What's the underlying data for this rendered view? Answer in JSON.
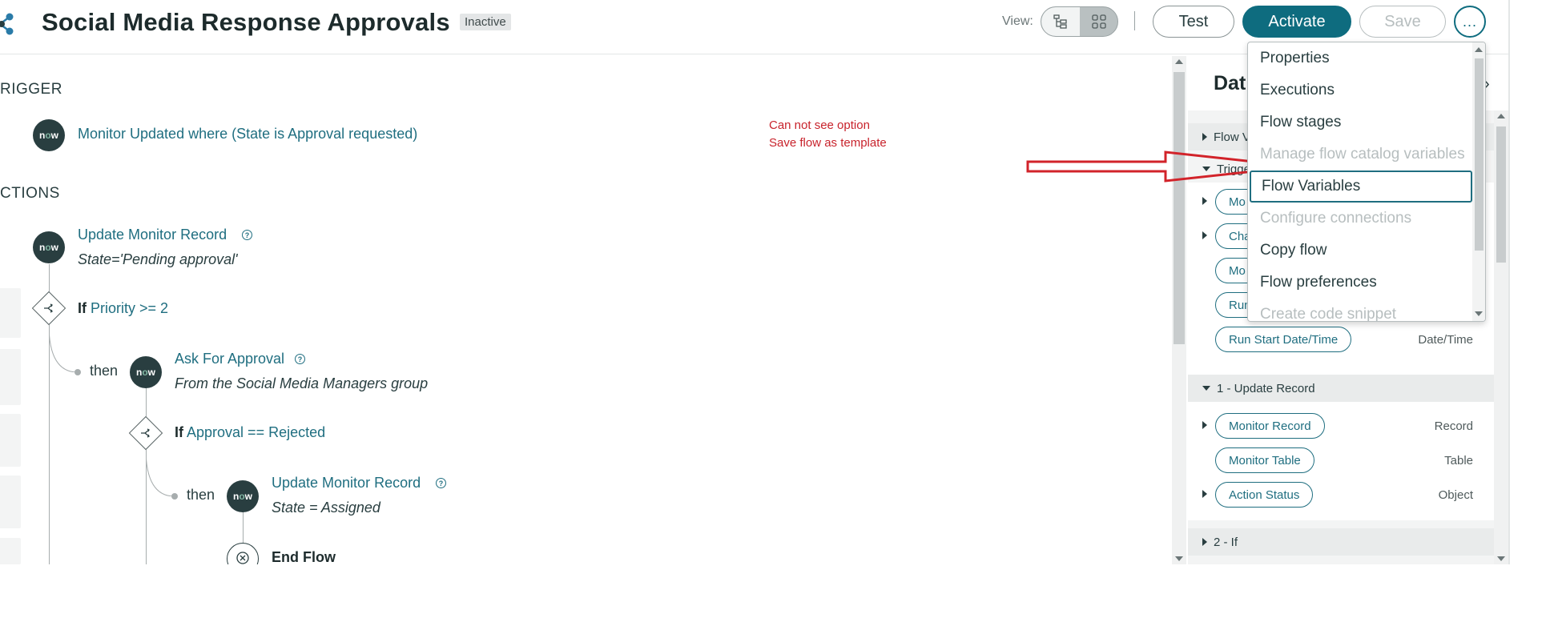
{
  "header": {
    "title": "Social Media Response Approvals",
    "status": "Inactive",
    "view_label": "View:",
    "test_label": "Test",
    "activate_label": "Activate",
    "save_label": "Save",
    "more_label": "..."
  },
  "colors": {
    "accent": "#0e6c7f",
    "link": "#1f6e80",
    "annotation": "#c8232c",
    "dark": "#293e40"
  },
  "canvas": {
    "trigger_label": "RIGGER",
    "actions_label": "CTIONS",
    "now_text_a": "n",
    "now_text_o": "o",
    "now_text_w": "w",
    "trigger_text": "Monitor Updated where (State is Approval requested)",
    "step1_title": "Update Monitor Record",
    "step1_detail": "State='Pending approval'",
    "if1_kw": "If",
    "if1_cond": "Priority >= 2",
    "then1": "then",
    "step2_title": "Ask For Approval",
    "step2_detail": "From the Social Media Managers group",
    "if2_kw": "If",
    "if2_cond": "Approval == Rejected",
    "then2": "then",
    "step3_title": "Update Monitor Record",
    "step3_detail": "State = Assigned",
    "end_label": "End Flow",
    "help_glyph": "?"
  },
  "annotation": {
    "line1": "Can not see option",
    "line2": "Save flow as template"
  },
  "data_panel": {
    "title": "Dat",
    "flow_variables": "Flow V",
    "trigger": "Trigge",
    "trigger_pills": [
      "Mo",
      "Cha",
      "Mo",
      "Run"
    ],
    "run_start_label": "Run Start Date/Time",
    "run_start_type": "Date/Time",
    "section_update": "1 - Update Record",
    "update_pills": [
      {
        "label": "Monitor Record",
        "type": "Record"
      },
      {
        "label": "Monitor Table",
        "type": "Table"
      },
      {
        "label": "Action Status",
        "type": "Object"
      }
    ],
    "section_if": "2 - If"
  },
  "menu": {
    "items": [
      {
        "label": "Properties",
        "state": "enabled"
      },
      {
        "label": "Executions",
        "state": "enabled"
      },
      {
        "label": "Flow stages",
        "state": "enabled"
      },
      {
        "label": "Manage flow catalog variables",
        "state": "disabled"
      },
      {
        "label": "Flow Variables",
        "state": "focused"
      },
      {
        "label": "Configure connections",
        "state": "disabled"
      },
      {
        "label": "Copy flow",
        "state": "enabled"
      },
      {
        "label": "Flow preferences",
        "state": "enabled"
      },
      {
        "label": "Create code snippet",
        "state": "disabled"
      }
    ]
  },
  "icons": {
    "flow": "flow-diagram-icon",
    "list_view": "list-view-icon",
    "grid_view": "grid-view-icon",
    "branch": "branch-icon",
    "end": "close-circle-icon",
    "arrow": "red-arrow-annotation"
  }
}
